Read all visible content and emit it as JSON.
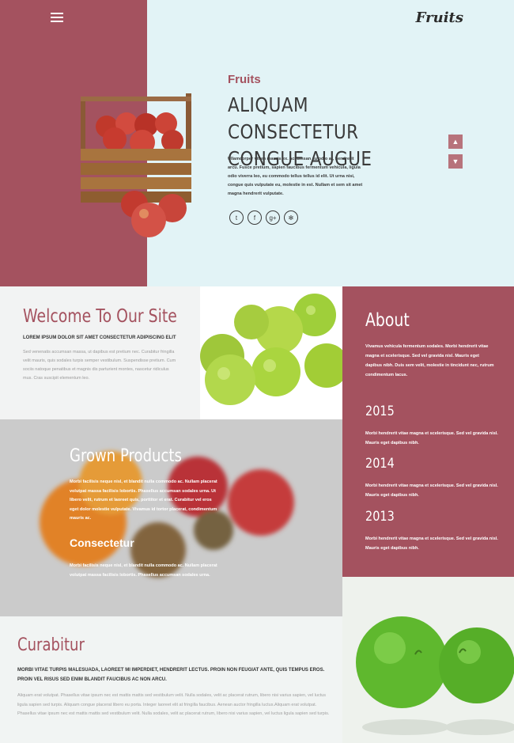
{
  "header": {
    "brand": "Fruits",
    "menu_icon": "menu-icon"
  },
  "hero": {
    "eyebrow": "Fruits",
    "title": "ALIQUAM CONSECTETUR CONGUE AUGUE",
    "text": "Ullamcorper vitam mauris ex. accumsan eu odio at, hendrerit arcu. Fusce pretium, sapien faucibus fermentum vehicula, ligula odio viverra leo, eu commodo tellus tellus id elit. Ut urna nisi, congue quis vulputate eu, molestie in est. Nullam et sem sit amet magna hendrerit vulputate.",
    "social_icons": [
      "twitter-icon",
      "facebook-icon",
      "google-plus-icon",
      "dribbble-icon"
    ],
    "social_glyphs": [
      "t",
      "f",
      "g+",
      "✻"
    ],
    "arrow_up": "▲",
    "arrow_down": "▼"
  },
  "welcome": {
    "title": "Welcome To Our Site",
    "subtitle": "LOREM IPSUM DOLOR SIT AMET CONSECTETUR ADIPISCING ELIT",
    "body": "Sed venenatis accumsan massa, ut dapibus est pretium nec. Curabitur fringilla velit mauris, quis sodales turpis semper vestibulum. Suspendisse pretium. Cum sociis natoque penatibus et magnis dis parturient montes, nascetur ridiculus mus. Cras suscipit elementum leo."
  },
  "about": {
    "title": "About",
    "intro": "Vivamus vehicula fermentum sodales. Morbi hendrerit vitae magna et scelerisque. Sed vel gravida nisl. Mauris eget dapibus nibh. Duis sem velit, molestie in tincidunt nec, rutrum condimentum lacus.",
    "years": [
      {
        "year": "2015",
        "text": "Morbi hendrerit vitae magna et scelerisque. Sed vel gravida nisl. Mauris eget dapibus nibh."
      },
      {
        "year": "2014",
        "text": "Morbi hendrerit vitae magna et scelerisque. Sed vel gravida nisl. Mauris eget dapibus nibh."
      },
      {
        "year": "2013",
        "text": "Morbi hendrerit vitae magna et scelerisque. Sed vel gravida nisl. Mauris eget dapibus nibh."
      }
    ]
  },
  "grown": {
    "title": "Grown Products",
    "p1": "Morbi facilisis neque nisl, et blandit nulla commodo ac. Nullam placerat volutpat massa facilisis lobortis. Phasellus accumsan sodales urna. Ut libero velit, rutrum et laoreet quis, porttitor et erat. Curabitur vel eros eget dolor molestie vulputate. Vivamus id tortor placerat, condimentum mauris ac.",
    "subtitle": "Consectetur",
    "p2": "Morbi facilisis neque nisl, et blandit nulla commodo ac. Nullam placerat volutpat massa facilisis lobortis. Phasellus accumsan sodales urna."
  },
  "curabitur": {
    "title": "Curabitur",
    "subtitle": "MORBI VITAE TURPIS MALESUADA, LAOREET MI IMPERDIET, HENDRERIT LECTUS. PROIN NON FEUGIAT ANTE, QUIS TEMPUS EROS. PROIN VEL RISUS SED ENIM BLANDIT FAUCIBUS AC NON ARCU.",
    "body": "Aliquam erat volutpat. Phasellus vitae ipsum nec est mattis mattis sed vestibulum velit. Nulla sodales, velit ac placerat rutrum, libero nisi varius sapien, vel luctus ligula sapien sed turpis. Aliquam congue placerat libero eu porta. Integer laoreet elit at fringilla faucibus. Aenean auctor fringilla luctus.Aliquam erat volutpat. Phasellus vitae ipsum nec est mattis mattis sed vestibulum velit. Nulla sodales, velit ac placerat rutrum, libero nisi varius sapien, vel luctus ligula sapien sed turpis."
  },
  "colors": {
    "accent": "#a4525f",
    "hero_bg": "#e2f3f6"
  }
}
